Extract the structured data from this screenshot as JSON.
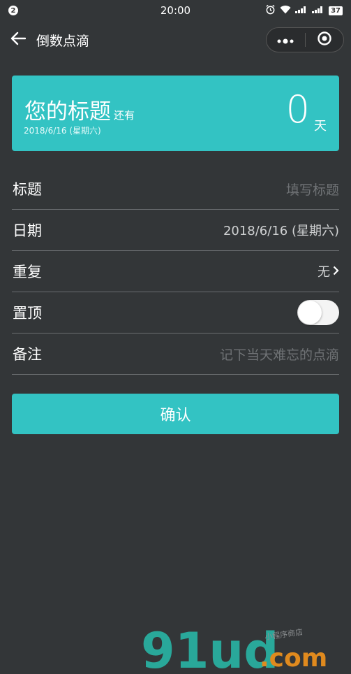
{
  "status_bar": {
    "notification_count": "2",
    "time": "20:00",
    "battery": "37",
    "icons": [
      "alarm-icon",
      "wifi-icon",
      "signal-icon",
      "signal-icon",
      "battery-icon"
    ]
  },
  "navbar": {
    "title": "倒数点滴",
    "back_icon": "arrow-left-icon",
    "menu_icon": "more-dots-icon",
    "close_icon": "target-circle-icon"
  },
  "card": {
    "title": "您的标题",
    "still_label": "还有",
    "date": "2018/6/16 (星期六)",
    "count": "0",
    "unit": "天",
    "color": "#33c3c3"
  },
  "form": {
    "title_label": "标题",
    "title_placeholder": "填写标题",
    "date_label": "日期",
    "date_value": "2018/6/16 (星期六)",
    "repeat_label": "重复",
    "repeat_value": "无",
    "pin_label": "置顶",
    "pin_enabled": false,
    "note_label": "备注",
    "note_placeholder": "记下当天难忘的点滴"
  },
  "confirm_label": "确认",
  "watermark": {
    "brand": "91ud",
    "domain": ".com",
    "tagline": "小程序商店"
  }
}
